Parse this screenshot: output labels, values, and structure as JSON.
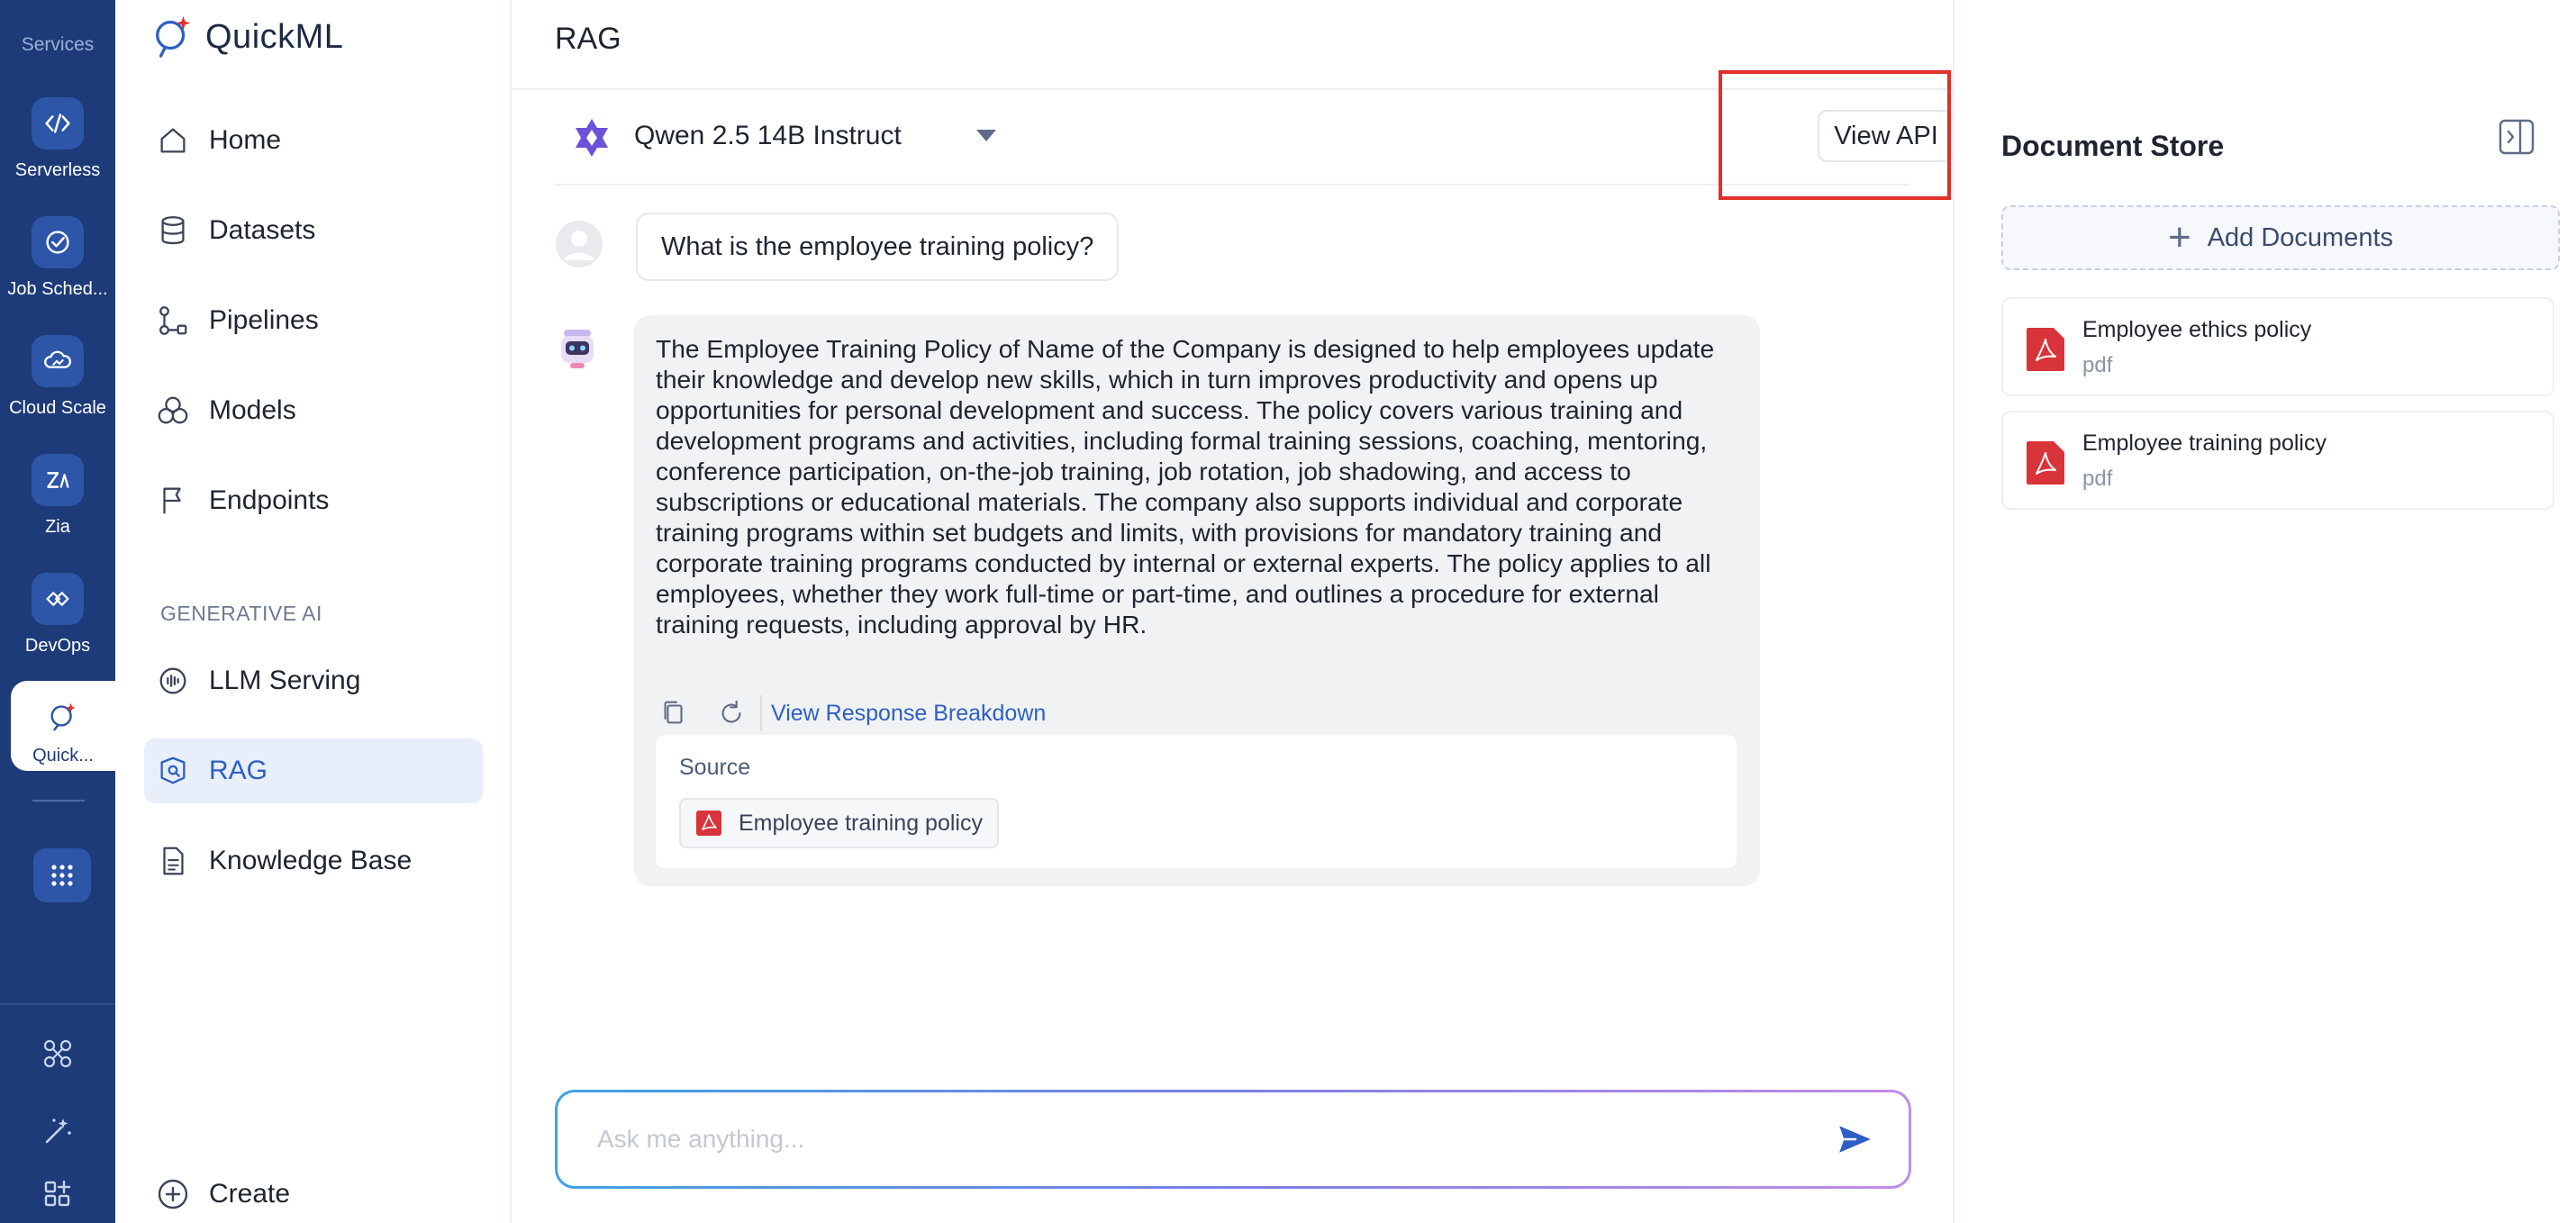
{
  "rail": {
    "header": "Services",
    "items": [
      {
        "label": "Serverless",
        "icon": "serverless-icon"
      },
      {
        "label": "Job Sched...",
        "icon": "job-scheduler-icon"
      },
      {
        "label": "Cloud Scale",
        "icon": "cloud-scale-icon"
      },
      {
        "label": "Zia",
        "icon": "zia-icon"
      },
      {
        "label": "DevOps",
        "icon": "devops-icon"
      },
      {
        "label": "Quick...",
        "icon": "quickml-icon"
      }
    ]
  },
  "sidebar": {
    "brand": "QuickML",
    "nav": [
      {
        "label": "Home",
        "icon": "home-icon"
      },
      {
        "label": "Datasets",
        "icon": "database-icon"
      },
      {
        "label": "Pipelines",
        "icon": "pipeline-icon"
      },
      {
        "label": "Models",
        "icon": "models-icon"
      },
      {
        "label": "Endpoints",
        "icon": "flag-icon"
      }
    ],
    "section_label": "GENERATIVE AI",
    "gen_nav": [
      {
        "label": "LLM Serving",
        "icon": "llm-serving-icon"
      },
      {
        "label": "RAG",
        "icon": "rag-icon",
        "active": true
      },
      {
        "label": "Knowledge Base",
        "icon": "document-icon"
      }
    ],
    "create_label": "Create"
  },
  "main": {
    "title": "RAG",
    "model_name": "Qwen 2.5 14B Instruct",
    "view_api_label": "View API",
    "user_message": "What is the employee training policy?",
    "bot_message": "The Employee Training Policy of Name of the Company is designed to help employees update their knowledge and develop new skills, which in turn improves productivity and opens up opportunities for personal development and success. The policy covers various training and development programs and activities, including formal training sessions, coaching, mentoring, conference participation, on-the-job training, job rotation, job shadowing, and access to subscriptions or educational materials. The company also supports individual and corporate training programs within set budgets and limits, with provisions for mandatory training and corporate training programs conducted by internal or external experts. The policy applies to all employees, whether they work full-time or part-time, and outlines a procedure for external training requests, including approval by HR.",
    "breakdown_label": "View Response Breakdown",
    "source_title": "Source",
    "source_doc": "Employee training policy",
    "input_placeholder": "Ask me anything...",
    "input_value": ""
  },
  "docstore": {
    "title": "Document Store",
    "add_label": "Add Documents",
    "documents": [
      {
        "name": "Employee ethics policy",
        "type": "pdf"
      },
      {
        "name": "Employee training policy",
        "type": "pdf"
      }
    ]
  },
  "colors": {
    "rail_bg": "#1d3b78",
    "accent": "#2d5fc4",
    "active_nav_bg": "#e8effb",
    "highlight": "#e1302a",
    "pdf_red": "#d9343a"
  }
}
